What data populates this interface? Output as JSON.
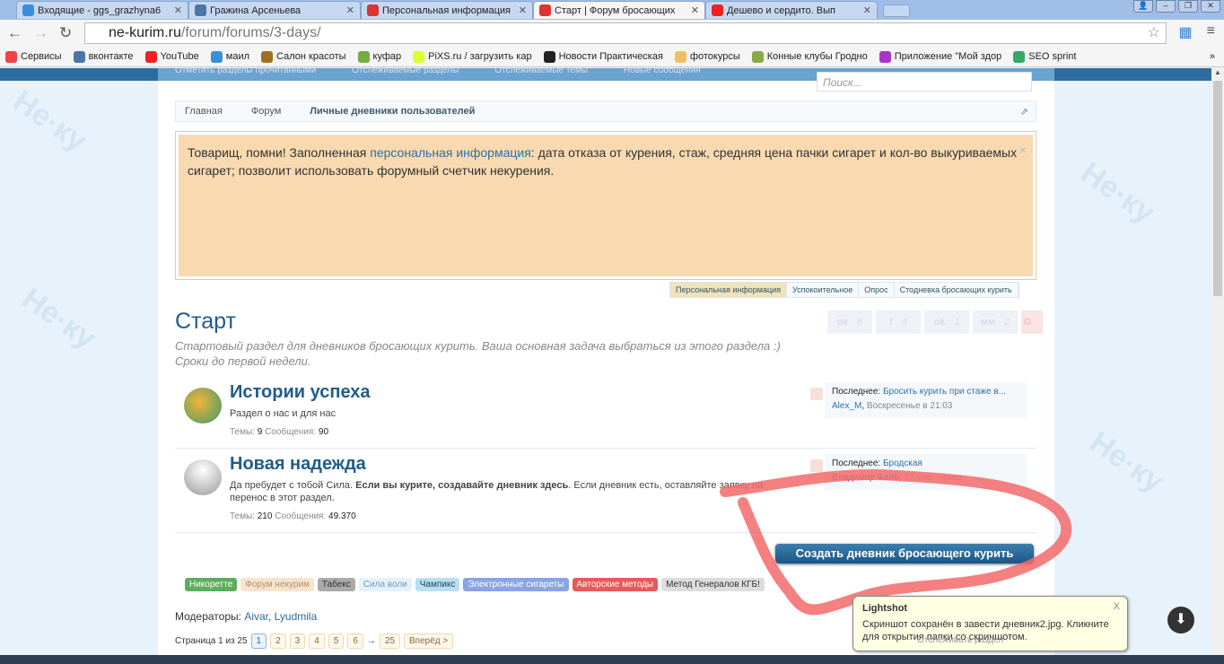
{
  "browser": {
    "tabs": [
      {
        "title": "Входящие - ggs_grazhyna6",
        "icon": "mail-icon",
        "color": "#3a8fd9"
      },
      {
        "title": "Гражина Арсеньева",
        "icon": "vk-icon",
        "color": "#4a76a8"
      },
      {
        "title": "Персональная информация",
        "icon": "no-smoking-icon",
        "color": "#d33"
      },
      {
        "title": "Старт | Форум бросающих",
        "icon": "no-smoking-icon",
        "color": "#d33",
        "active": true
      },
      {
        "title": "Дешево и сердито. Вып",
        "icon": "youtube-icon",
        "color": "#e22"
      }
    ],
    "url_host": "ne-kurim.ru",
    "url_path": "/forum/forums/3-days/",
    "bookmarks": [
      {
        "label": "Сервисы",
        "color": "#e44"
      },
      {
        "label": "вконтакте",
        "color": "#4a76a8"
      },
      {
        "label": "YouTube",
        "color": "#e22"
      },
      {
        "label": "маил",
        "color": "#3a8fd9"
      },
      {
        "label": "Салон красоты",
        "color": "#a07020"
      },
      {
        "label": "куфар",
        "color": "#7a4"
      },
      {
        "label": "PiXS.ru / загрузить кар",
        "color": "#df3"
      },
      {
        "label": "Новости Практическая",
        "color": "#222"
      },
      {
        "label": "фотокурсы",
        "color": "#f0c060"
      },
      {
        "label": "Конные клубы Гродно",
        "color": "#8a4"
      },
      {
        "label": "Приложение \"Мой здор",
        "color": "#a3c"
      },
      {
        "label": "SEO sprint",
        "color": "#3a6"
      }
    ],
    "more": "»"
  },
  "site": {
    "nav_links": [
      "Отметить разделы прочитанными",
      "Отслеживаемые разделы",
      "Отслеживаемые темы",
      "Новые сообщения"
    ],
    "search_placeholder": "Поиск...",
    "breadcrumbs": [
      "Главная",
      "Форум",
      "Личные дневники пользователей"
    ],
    "notice": {
      "before": "Товарищ, помни! Заполненная ",
      "link": "персональная информация",
      "after": ": дата отказа от курения, стаж, средняя цена пачки сигарет и кол-во выкуриваемых сигарет; позволит использовать форумный счетчик некурения.",
      "close": "×"
    },
    "notice_tabs": [
      "Персональная информация",
      "Успокоительное",
      "Опрос",
      "Стодневка бросающих курить"
    ],
    "title": "Старт",
    "description": [
      "Стартовый раздел для дневников бросающих курить. Ваша основная задача выбраться из этого раздела :)",
      "Сроки до первой недели."
    ],
    "social": [
      {
        "label": "вк",
        "count": "6"
      },
      {
        "label": "f",
        "count": "4"
      },
      {
        "label": "ok",
        "count": "1"
      },
      {
        "label": "мм",
        "count": "2"
      },
      {
        "label": "G",
        "count": ""
      }
    ],
    "forums": [
      {
        "title": "Истории успеха",
        "desc": "Раздел о нас и для нас",
        "desc_bold": "",
        "desc_after": "",
        "topics_label": "Темы:",
        "topics": "9",
        "posts_label": "Сообщения:",
        "posts": "90",
        "last_label": "Последнее:",
        "last_title": "Бросить курить при стаже в...",
        "last_user": "Alex_M",
        "last_time": "Воскресенье в 21:03"
      },
      {
        "title": "Новая надежда",
        "desc": "Да пребудет с тобой Сила. ",
        "desc_bold": "Если вы курите, создавайте дневник здесь",
        "desc_after": ". Если дневник есть, оставляйте заявку на перенос в этот раздел.",
        "topics_label": "Темы:",
        "topics": "210",
        "posts_label": "Сообщения:",
        "posts": "49.370",
        "last_label": "Последнее:",
        "last_title": "Бродская",
        "last_user": "Владимир Файб",
        "last_time": "27 мин. назад"
      }
    ],
    "create_button": "Создать дневник бросающего курить",
    "tags": [
      {
        "label": "Никоретте",
        "bg": "#5cae5c",
        "fg": "#fff"
      },
      {
        "label": "Форум некурим",
        "bg": "#f8e4cc",
        "fg": "#b09070"
      },
      {
        "label": "Табекс",
        "bg": "#aaa",
        "fg": "#333"
      },
      {
        "label": "Сила воли",
        "bg": "#e6f2fb",
        "fg": "#6a9ac0"
      },
      {
        "label": "Чампикс",
        "bg": "#b8e0f4",
        "fg": "#245"
      },
      {
        "label": "Электронные сигареты",
        "bg": "#8aa4e4",
        "fg": "#fff"
      },
      {
        "label": "Авторские методы",
        "bg": "#e85a5a",
        "fg": "#fff"
      },
      {
        "label": "Метод Генералов КГБ!",
        "bg": "#ddd",
        "fg": "#333"
      }
    ],
    "moderators_label": "Модераторы:",
    "moderators": [
      "Aivar",
      "Lyudmila"
    ],
    "pager": {
      "label": "Страница 1 из 25",
      "pages": [
        "1",
        "2",
        "3",
        "4",
        "5",
        "6"
      ],
      "arrow": "→",
      "last": "25",
      "next": "Вперёд >"
    },
    "watch": "Отслеживать раздел"
  },
  "toast": {
    "title": "Lightshot",
    "text": "Скриншот сохранён в завести дневник2.jpg. Кликните для открытия папки со скриншотом.",
    "close": "X"
  },
  "annotation_color": "#f26a6a"
}
